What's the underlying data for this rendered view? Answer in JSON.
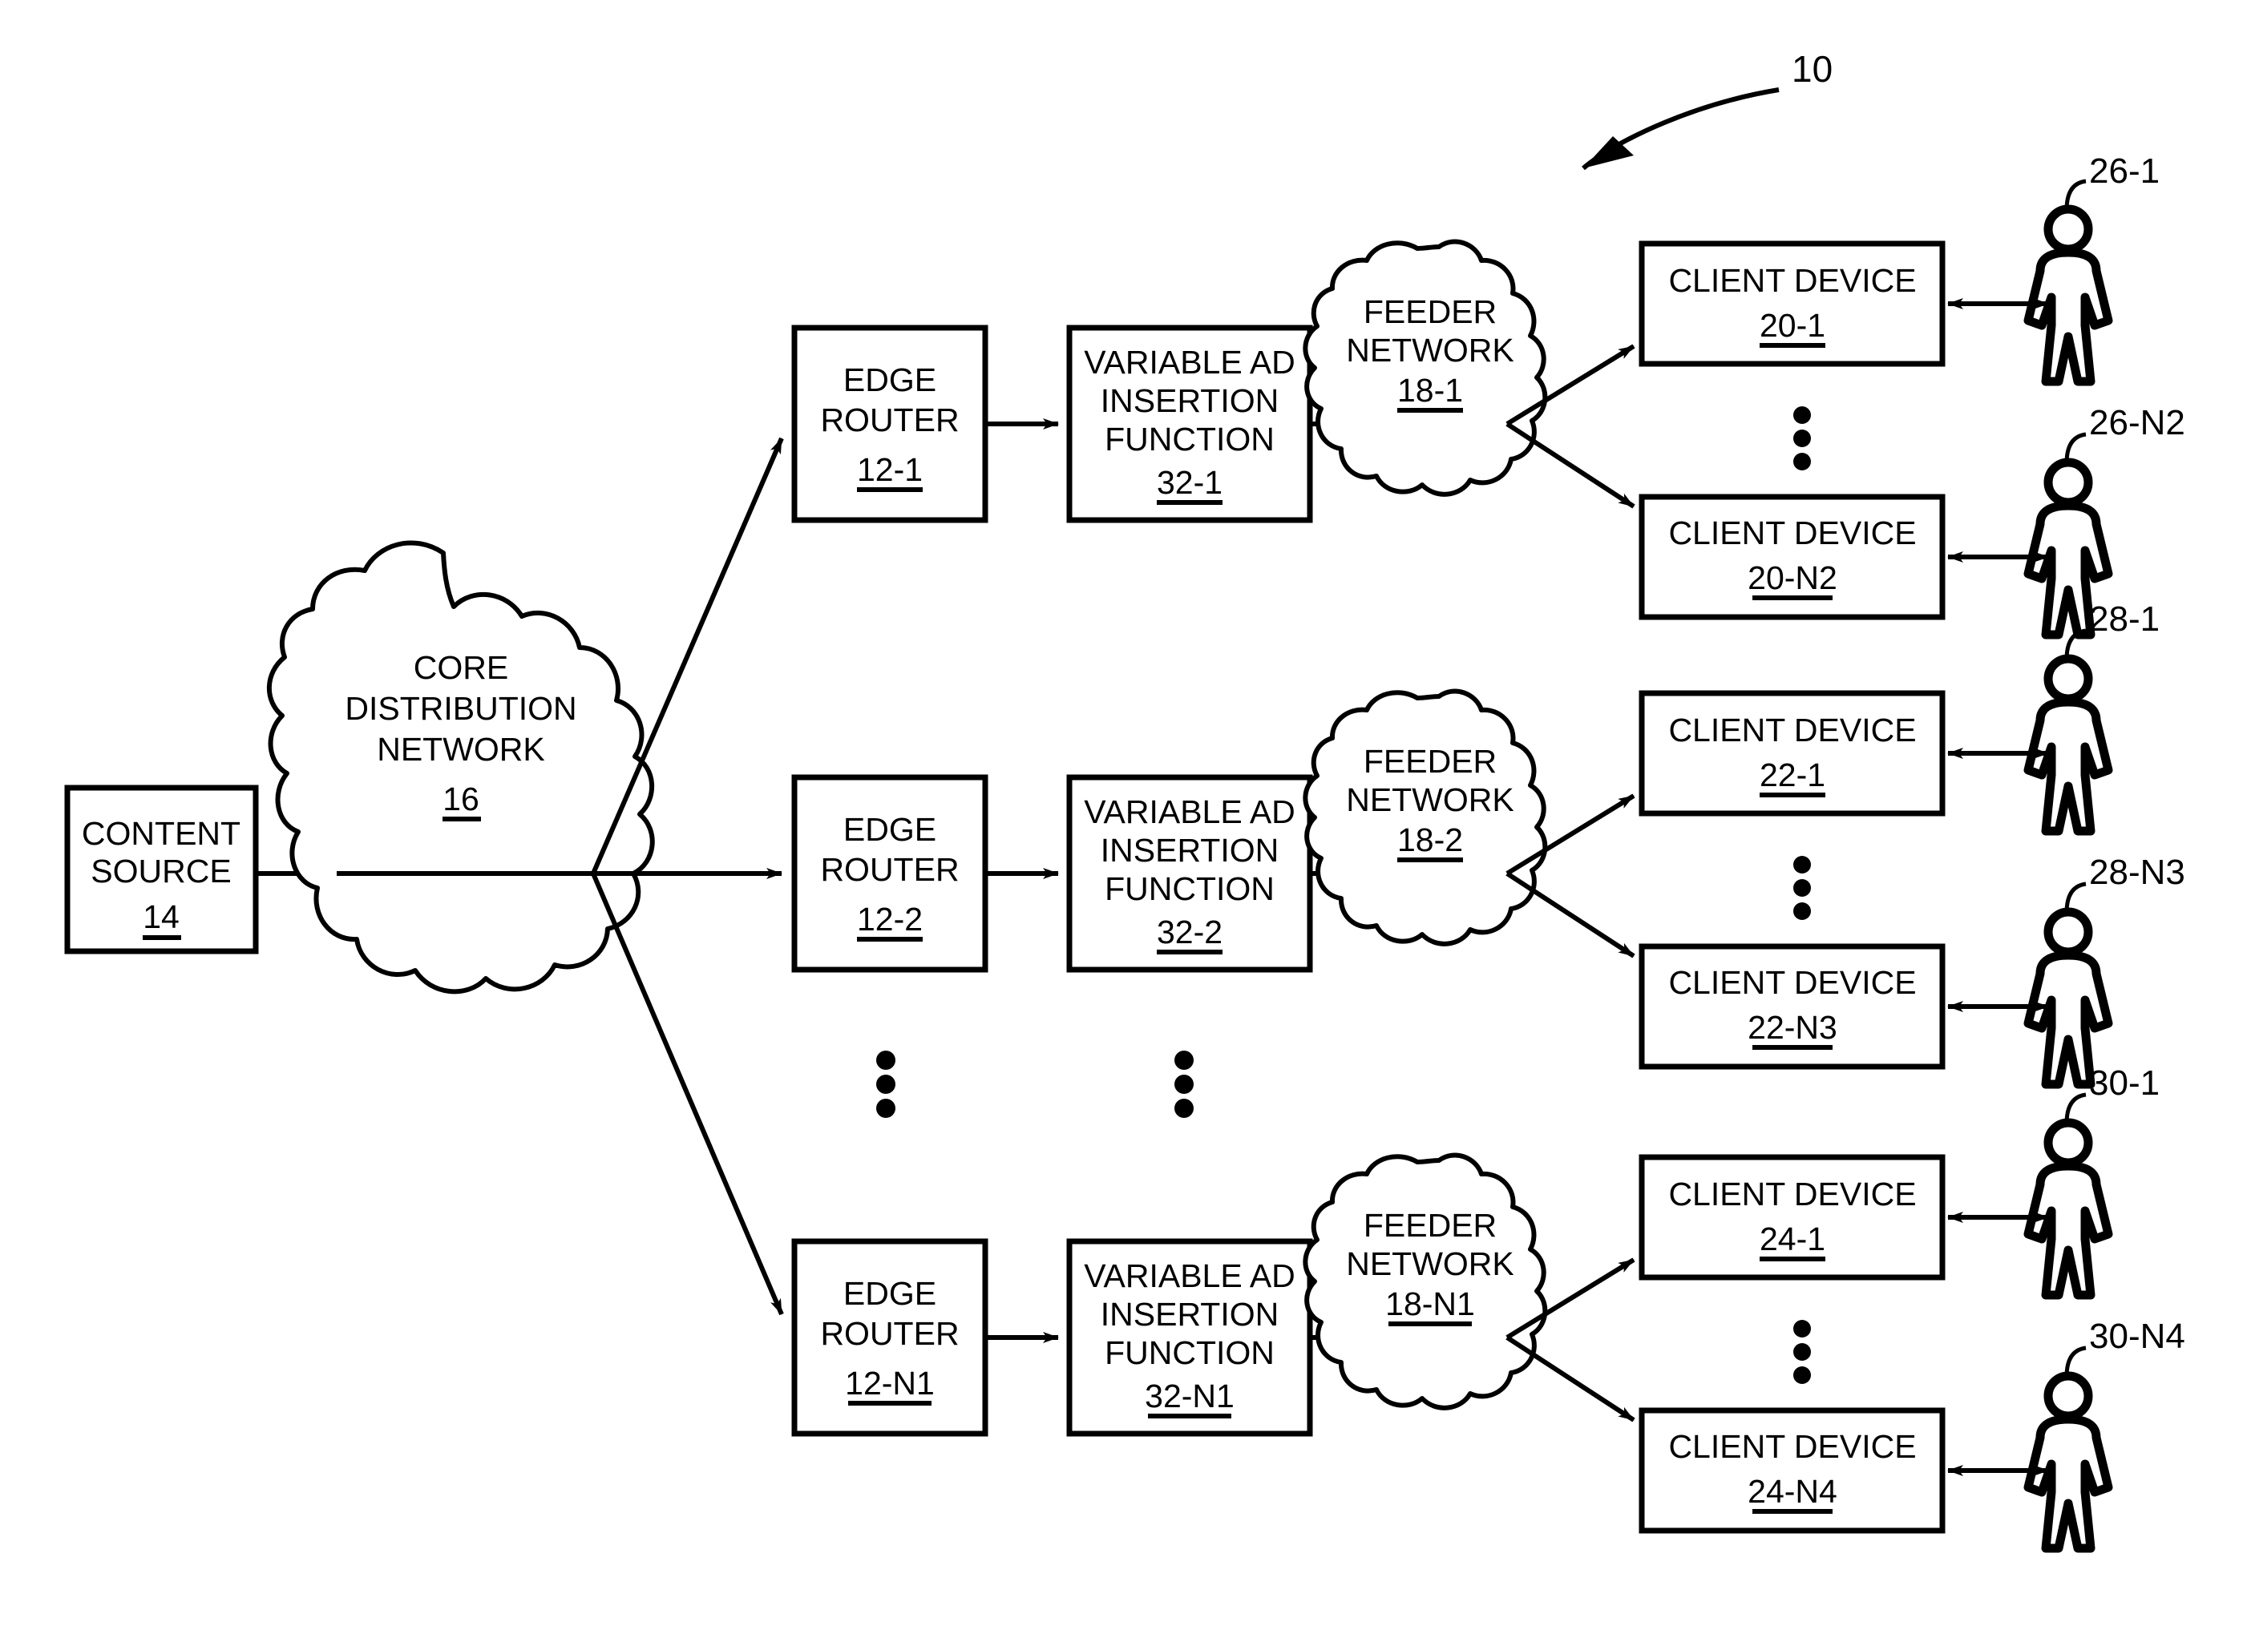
{
  "figure": {
    "reference_number": "10",
    "background_color": "#ffffff",
    "line_color": "#000000"
  },
  "nodes": {
    "content_source": {
      "label_line1": "CONTENT",
      "label_line2": "SOURCE",
      "ref": "14"
    },
    "core_network": {
      "label_line1": "CORE",
      "label_line2": "DISTRIBUTION",
      "label_line3": "NETWORK",
      "ref": "16"
    }
  },
  "rows": [
    {
      "edge_router": {
        "label_line1": "EDGE",
        "label_line2": "ROUTER",
        "ref": "12-1"
      },
      "ad_function": {
        "label_line1": "VARIABLE AD",
        "label_line2": "INSERTION",
        "label_line3": "FUNCTION",
        "ref": "32-1"
      },
      "feeder_network": {
        "label_line1": "FEEDER",
        "label_line2": "NETWORK",
        "ref": "18-1"
      },
      "clients": [
        {
          "label": "CLIENT DEVICE",
          "ref": "20-1",
          "user_ref": "26-1"
        },
        {
          "label": "CLIENT DEVICE",
          "ref": "20-N2",
          "user_ref": "26-N2"
        }
      ]
    },
    {
      "edge_router": {
        "label_line1": "EDGE",
        "label_line2": "ROUTER",
        "ref": "12-2"
      },
      "ad_function": {
        "label_line1": "VARIABLE AD",
        "label_line2": "INSERTION",
        "label_line3": "FUNCTION",
        "ref": "32-2"
      },
      "feeder_network": {
        "label_line1": "FEEDER",
        "label_line2": "NETWORK",
        "ref": "18-2"
      },
      "clients": [
        {
          "label": "CLIENT DEVICE",
          "ref": "22-1",
          "user_ref": "28-1"
        },
        {
          "label": "CLIENT DEVICE",
          "ref": "22-N3",
          "user_ref": "28-N3"
        }
      ]
    },
    {
      "edge_router": {
        "label_line1": "EDGE",
        "label_line2": "ROUTER",
        "ref": "12-N1"
      },
      "ad_function": {
        "label_line1": "VARIABLE AD",
        "label_line2": "INSERTION",
        "label_line3": "FUNCTION",
        "ref": "32-N1"
      },
      "feeder_network": {
        "label_line1": "FEEDER",
        "label_line2": "NETWORK",
        "ref": "18-N1"
      },
      "clients": [
        {
          "label": "CLIENT DEVICE",
          "ref": "24-1",
          "user_ref": "30-1"
        },
        {
          "label": "CLIENT DEVICE",
          "ref": "24-N4",
          "user_ref": "30-N4"
        }
      ]
    }
  ]
}
